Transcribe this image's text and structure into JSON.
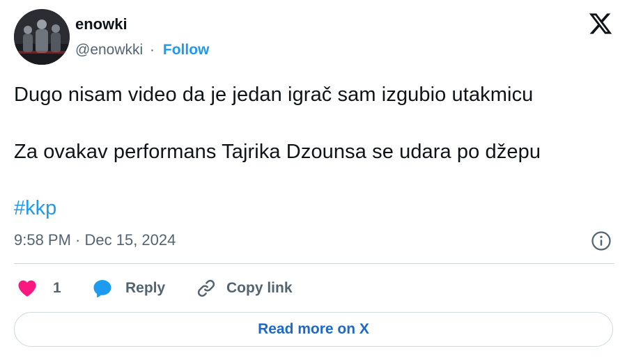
{
  "author": {
    "display_name": "enowki",
    "handle": "@enowkki",
    "separator": "·",
    "follow_label": "Follow"
  },
  "brand_icon": "x-logo-icon",
  "tweet": {
    "lines": [
      "Dugo nisam video da je jedan igrač sam izgubio utakmicu",
      "Za ovakav performans Tajrika Dzounsa se udara po džepu"
    ],
    "hashtag": "#kkp",
    "timestamp": "9:58 PM · Dec 15, 2024"
  },
  "actions": {
    "like_count": "1",
    "reply_label": "Reply",
    "copy_link_label": "Copy link"
  },
  "footer": {
    "read_more_label": "Read more on X"
  },
  "colors": {
    "accent": "#1d9bf0",
    "heart": "#f91880",
    "text": "#0f1419",
    "secondary_text": "#536471",
    "border": "#cfd9de"
  }
}
